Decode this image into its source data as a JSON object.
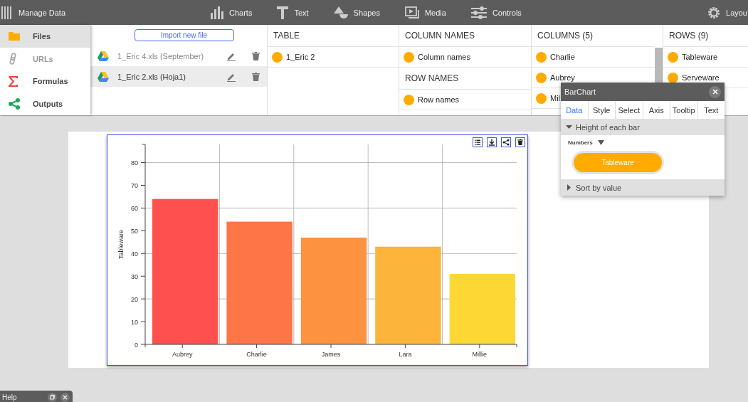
{
  "toolbar": {
    "title": "Manage Data",
    "items": [
      {
        "kind": "charts",
        "label": "Charts"
      },
      {
        "kind": "text",
        "label": "Text"
      },
      {
        "kind": "shapes",
        "label": "Shapes"
      },
      {
        "kind": "media",
        "label": "Media"
      },
      {
        "kind": "controls",
        "label": "Controls"
      }
    ],
    "layout": "Layou"
  },
  "sidebar": {
    "items": [
      {
        "kind": "files",
        "label": "Files",
        "selected": true,
        "disabled": false
      },
      {
        "kind": "urls",
        "label": "URLs",
        "selected": false,
        "disabled": true
      },
      {
        "kind": "formulas",
        "label": "Formulas",
        "selected": false,
        "disabled": false
      },
      {
        "kind": "outputs",
        "label": "Outputs",
        "selected": false,
        "disabled": false
      }
    ]
  },
  "files": {
    "import_button": "Import new file",
    "items": [
      {
        "name": "1_Eric 4.xls (September)",
        "selected": false,
        "disabled": true
      },
      {
        "name": "1_Eric 2.xls (Hoja1)",
        "selected": true,
        "disabled": false
      }
    ]
  },
  "panels": [
    {
      "sections": [
        {
          "title": "TABLE",
          "items": [
            "1_Eric 2"
          ]
        }
      ]
    },
    {
      "sections": [
        {
          "title": "COLUMN NAMES",
          "items": [
            "Column names"
          ]
        },
        {
          "title": "ROW NAMES",
          "items": [
            "Row names"
          ]
        }
      ]
    },
    {
      "scrollbar": true,
      "sections": [
        {
          "title": "COLUMNS (5)",
          "items": [
            "Charlie",
            "Aubrey",
            "Mil"
          ]
        }
      ]
    },
    {
      "sections": [
        {
          "title": "ROWS (9)",
          "items": [
            "Tableware",
            "Serveware"
          ]
        }
      ]
    }
  ],
  "chart_data": {
    "type": "bar",
    "grid": true,
    "categories": [
      "Aubrey",
      "Charlie",
      "James",
      "Lara",
      "Millie"
    ],
    "series": [
      {
        "name": "Tableware",
        "colors": [
          "#ff5050",
          "#fe7547",
          "#fd9340",
          "#fdb43a",
          "#fdd835"
        ],
        "values": [
          64,
          54,
          47,
          43,
          31
        ]
      }
    ],
    "ylim": [
      0,
      88
    ],
    "yticks": [
      0,
      10,
      20,
      30,
      40,
      50,
      60,
      70,
      80
    ]
  },
  "popup": {
    "title": "BarChart",
    "tabs": [
      {
        "label": "Data",
        "selected": true
      },
      {
        "label": "Style",
        "selected": false
      },
      {
        "label": "Select",
        "selected": false
      },
      {
        "label": "Axis",
        "selected": false
      },
      {
        "label": "Tooltip",
        "selected": false
      },
      {
        "label": "Text",
        "selected": false
      }
    ],
    "sections": [
      {
        "title": "Height of each bar",
        "expanded": true,
        "dropdown": "Numbers",
        "pill": "Tableware"
      },
      {
        "title": "Sort by value",
        "expanded": false
      }
    ]
  },
  "help": {
    "title": "Help"
  }
}
